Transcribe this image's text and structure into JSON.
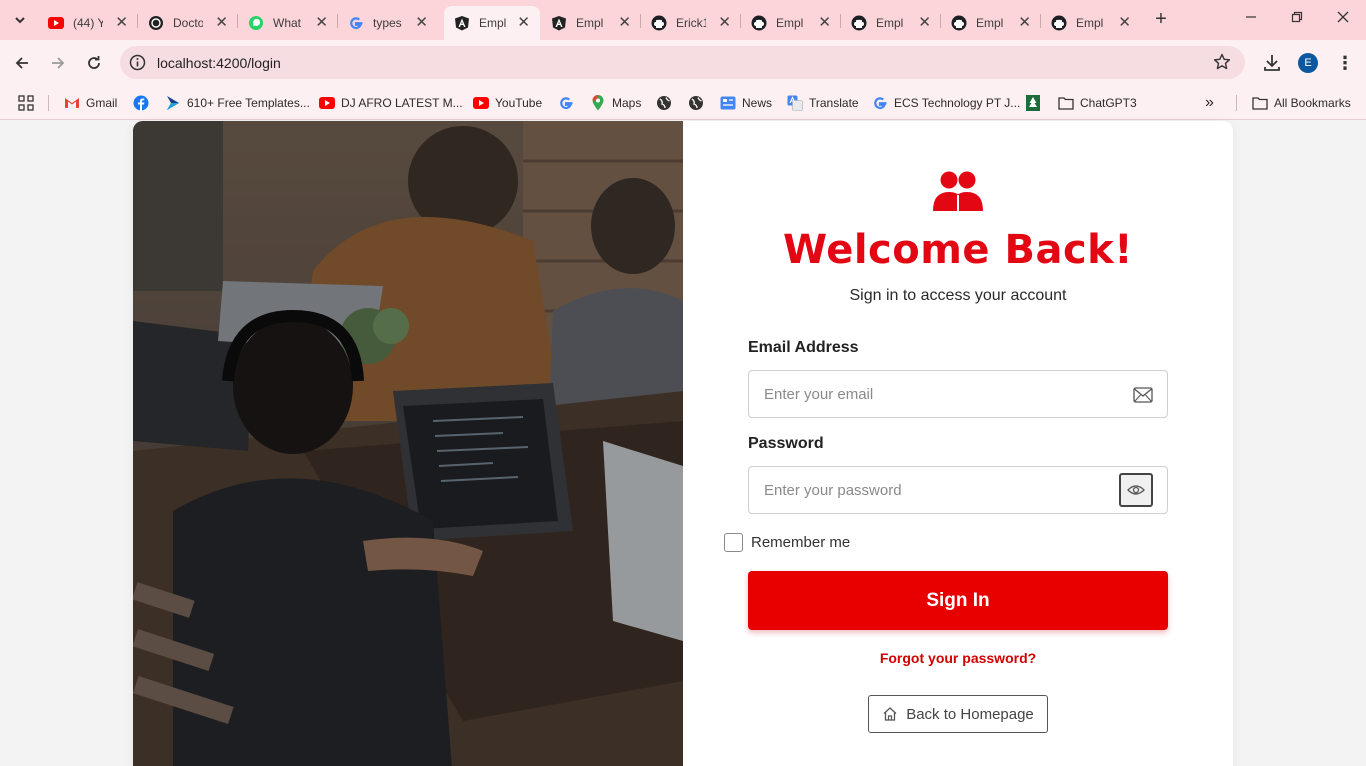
{
  "browser": {
    "tabs": [
      {
        "title": "(44) Y",
        "icon": "youtube-icon"
      },
      {
        "title": "Docto",
        "icon": "chatgpt-icon"
      },
      {
        "title": "What",
        "icon": "whatsapp-icon"
      },
      {
        "title": "types",
        "icon": "google-icon"
      },
      {
        "title": "Empl",
        "icon": "angular-icon",
        "active": true
      },
      {
        "title": "Empl",
        "icon": "angular-icon"
      },
      {
        "title": "Erick1",
        "icon": "github-icon"
      },
      {
        "title": "Empl",
        "icon": "github-icon"
      },
      {
        "title": "Empl",
        "icon": "github-icon"
      },
      {
        "title": "Empl",
        "icon": "github-icon"
      },
      {
        "title": "Empl",
        "icon": "github-icon"
      }
    ],
    "close_glyph": "✕",
    "new_tab_glyph": "+",
    "url": "localhost:4200/login",
    "profile_initial": "E",
    "bookmarks": [
      {
        "label": "Gmail",
        "icon": "gmail-icon"
      },
      {
        "label": "",
        "icon": "facebook-icon"
      },
      {
        "label": "610+ Free Templates...",
        "icon": "template-icon"
      },
      {
        "label": "DJ AFRO LATEST M...",
        "icon": "youtube-icon"
      },
      {
        "label": "YouTube",
        "icon": "youtube-icon"
      },
      {
        "label": "",
        "icon": "google-icon"
      },
      {
        "label": "Maps",
        "icon": "maps-icon"
      },
      {
        "label": "",
        "icon": "globe-icon"
      },
      {
        "label": "",
        "icon": "globe-icon"
      },
      {
        "label": "News",
        "icon": "news-icon"
      },
      {
        "label": "Translate",
        "icon": "translate-icon"
      },
      {
        "label": "ECS Technology PT J...",
        "icon": "google-icon"
      },
      {
        "label": "",
        "icon": "tree-icon"
      },
      {
        "label": "ChatGPT3",
        "icon": "folder-icon"
      }
    ],
    "overflow_glyph": "»",
    "all_bookmarks": "All Bookmarks"
  },
  "login": {
    "title": "Welcome Back!",
    "subtitle": "Sign in to access your account",
    "email_label": "Email Address",
    "email_placeholder": "Enter your email",
    "password_label": "Password",
    "password_placeholder": "Enter your password",
    "remember_label": "Remember me",
    "signin_label": "Sign In",
    "forgot_label": "Forgot your password?",
    "back_label": "Back to Homepage"
  },
  "colors": {
    "brand_red": "#e30613",
    "button_red": "#e80000",
    "tabstrip_pink": "#fcd5da"
  }
}
